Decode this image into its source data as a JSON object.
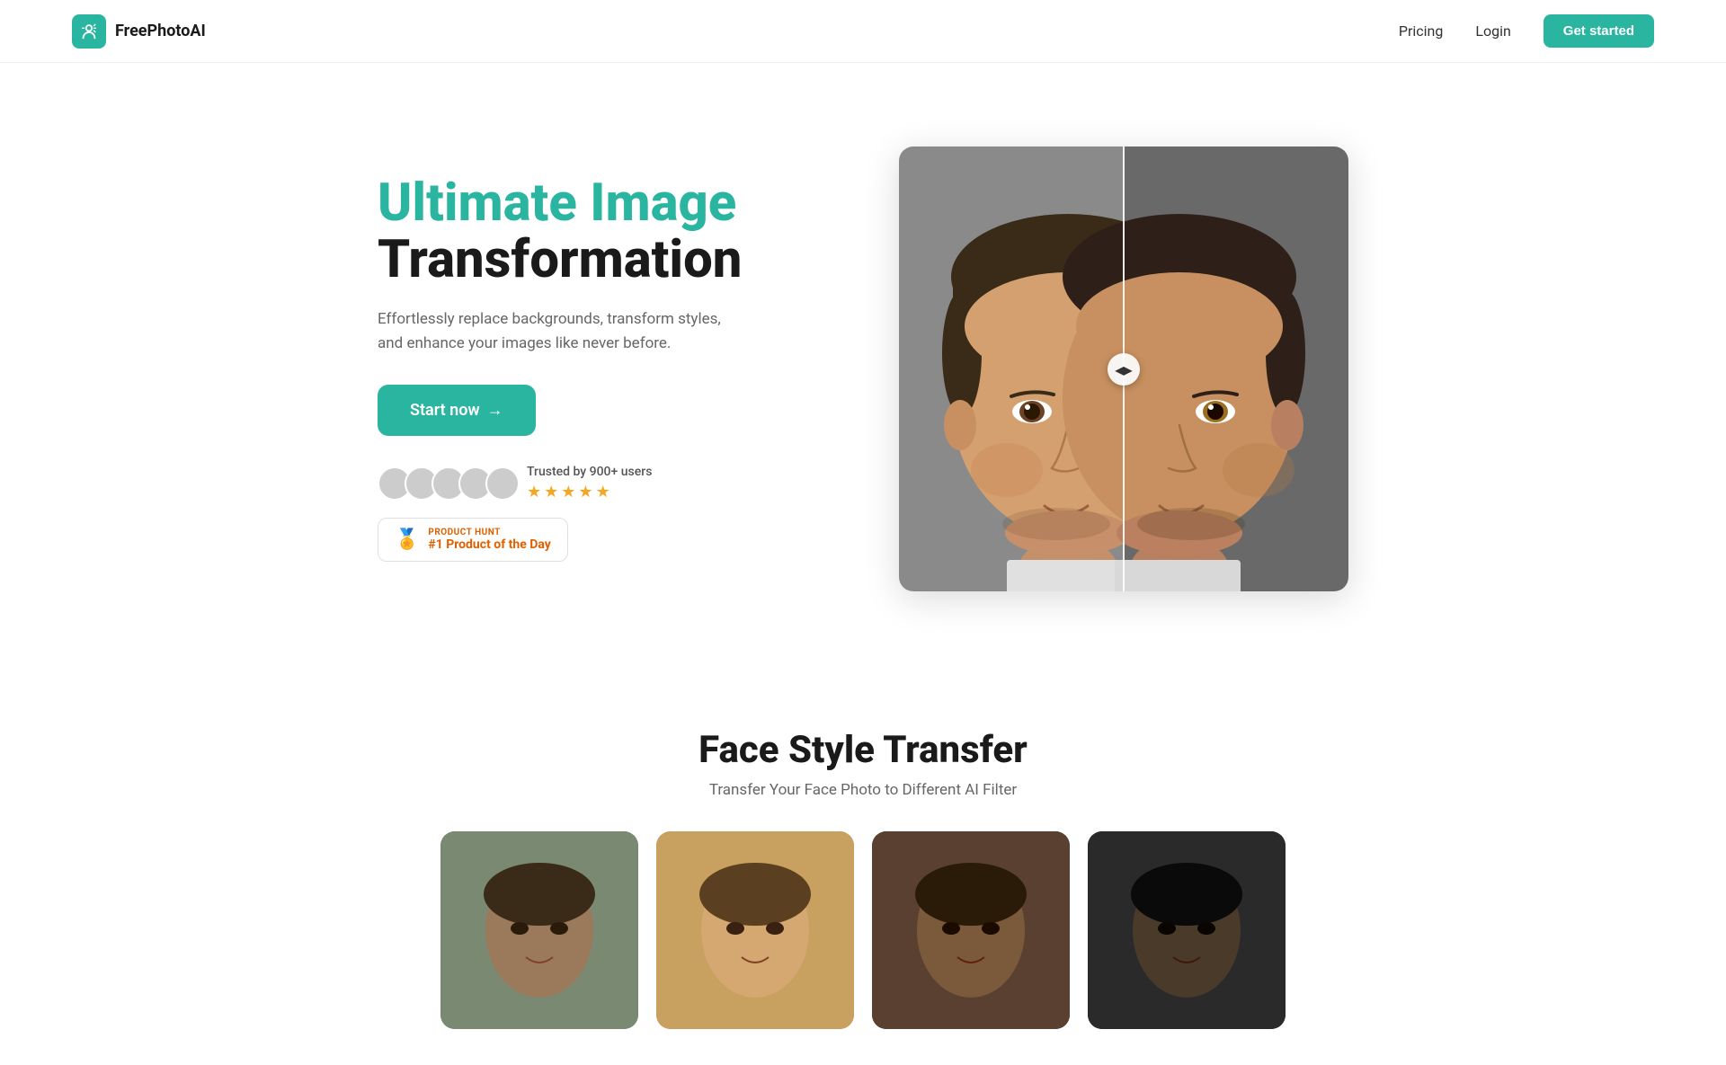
{
  "nav": {
    "logo_text": "FreePhotoAI",
    "pricing_label": "Pricing",
    "login_label": "Login",
    "get_started_label": "Get started"
  },
  "hero": {
    "title_line1": "Ultimate Image",
    "title_line2": "Transformation",
    "subtitle": "Effortlessly replace backgrounds, transform styles, and enhance your images like never before.",
    "cta_label": "Start now",
    "cta_arrow": "→",
    "trust_text": "Trusted by 900+ users",
    "stars": [
      "★",
      "★",
      "★",
      "★",
      "★"
    ],
    "product_hunt_label": "PRODUCT HUNT",
    "product_hunt_title": "#1 Product of the Day",
    "divider_handle": "◀▶"
  },
  "face_style_section": {
    "title": "Face Style Transfer",
    "subtitle": "Transfer Your Face Photo to Different AI Filter"
  },
  "colors": {
    "brand": "#2ab5a0",
    "ph_orange": "#e06000",
    "star_gold": "#f5a623"
  }
}
